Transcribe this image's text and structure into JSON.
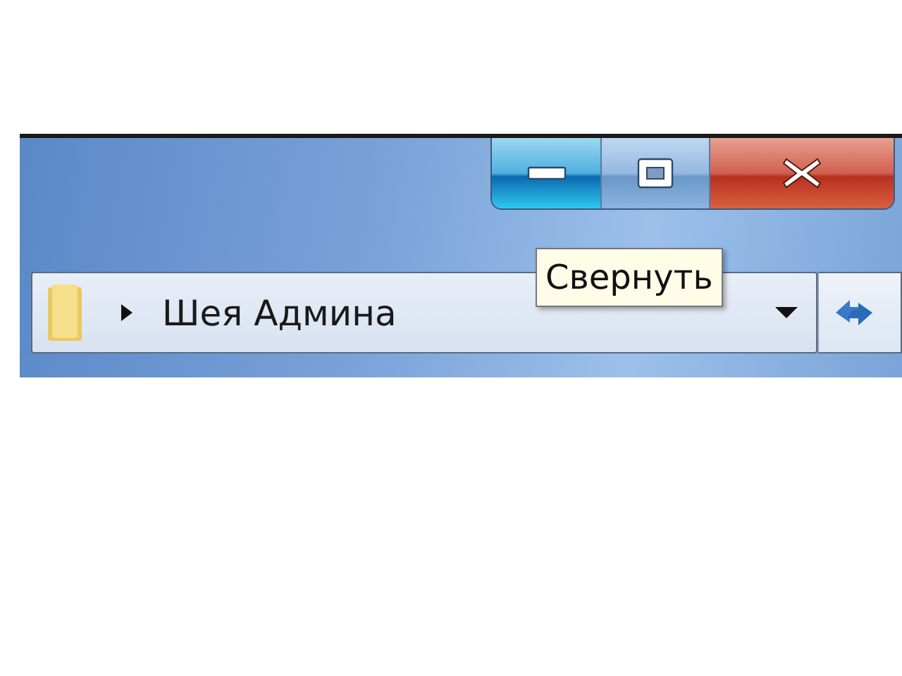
{
  "caption_buttons": [
    {
      "kind": "minimize",
      "hovered": true
    },
    {
      "kind": "maximize",
      "hovered": false
    },
    {
      "kind": "close",
      "hovered": false
    }
  ],
  "address_bar": {
    "breadcrumbs": [
      "Шея Админа"
    ]
  },
  "tooltip": {
    "text": "Свернуть"
  }
}
